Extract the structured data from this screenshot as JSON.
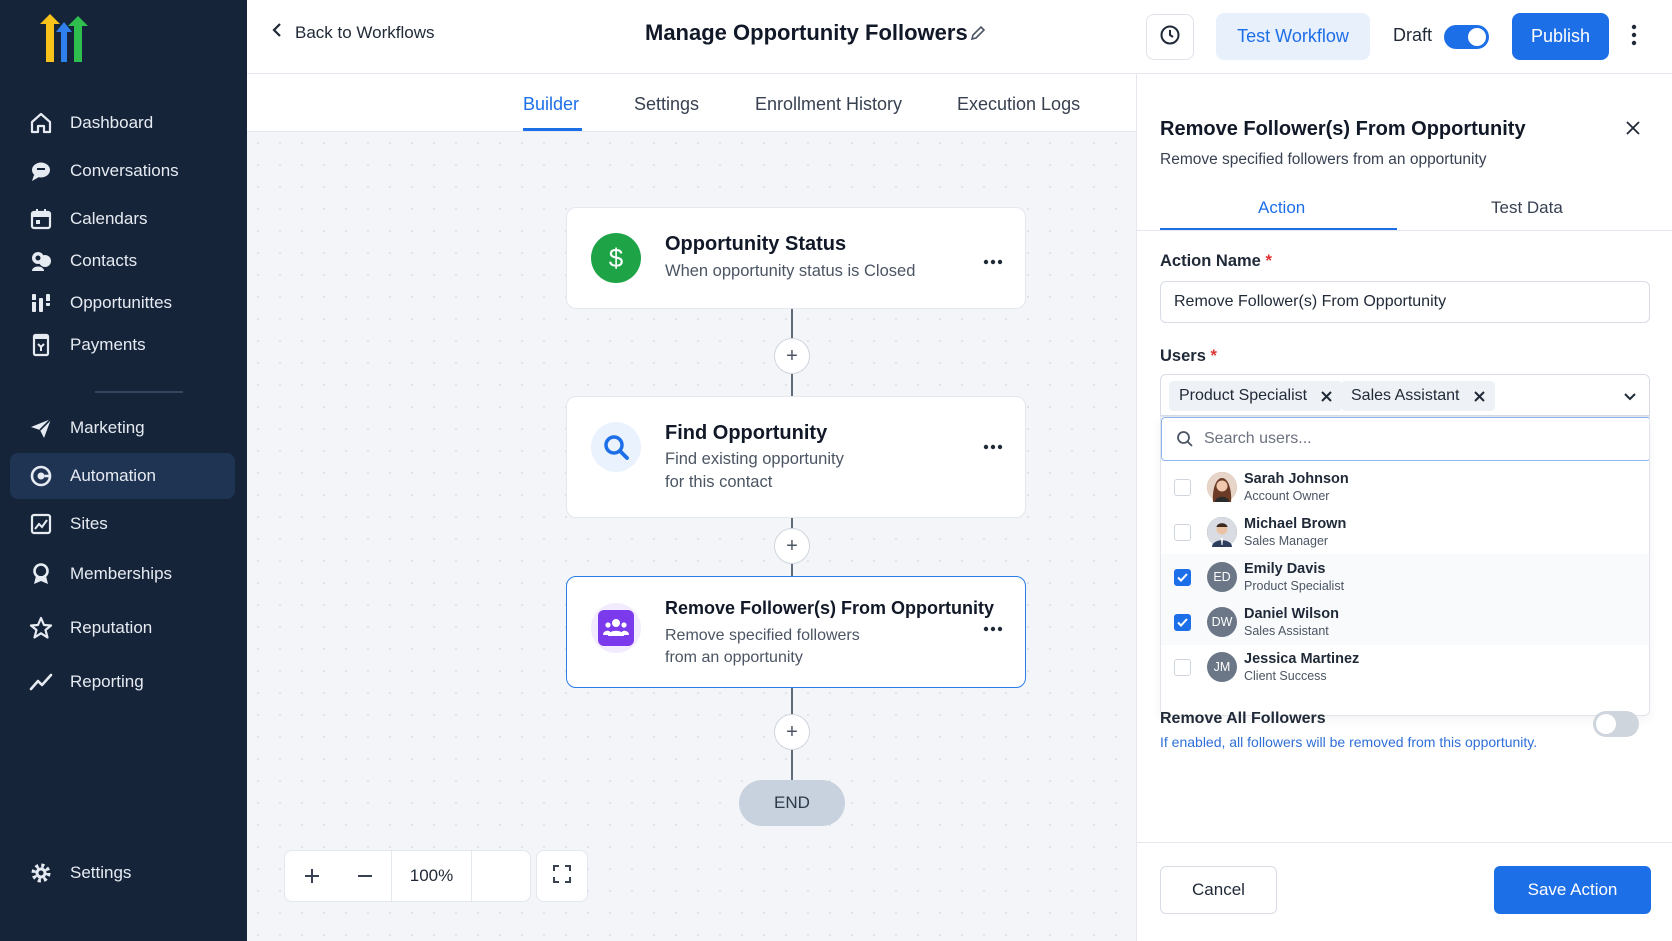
{
  "sidebar": {
    "items": [
      {
        "label": "Dashboard",
        "icon": "home-icon"
      },
      {
        "label": "Conversations",
        "icon": "chat-icon"
      },
      {
        "label": "Calendars",
        "icon": "calendar-icon"
      },
      {
        "label": "Contacts",
        "icon": "contacts-icon"
      },
      {
        "label": "Opportunittes",
        "icon": "opportunities-icon"
      },
      {
        "label": "Payments",
        "icon": "payments-icon"
      },
      {
        "label": "Marketing",
        "icon": "send-icon"
      },
      {
        "label": "Automation",
        "icon": "automation-icon",
        "active": true
      },
      {
        "label": "Sites",
        "icon": "sites-icon"
      },
      {
        "label": "Memberships",
        "icon": "membership-icon"
      },
      {
        "label": "Reputation",
        "icon": "star-icon"
      },
      {
        "label": "Reporting",
        "icon": "chart-line-icon"
      },
      {
        "label": "Settings",
        "icon": "gear-icon"
      }
    ]
  },
  "header": {
    "back_label": "Back to Workflows",
    "title": "Manage Opportunity Followers",
    "test_label": "Test Workflow",
    "draft_label": "Draft",
    "publish_label": "Publish"
  },
  "tabs": [
    "Builder",
    "Settings",
    "Enrollment History",
    "Execution Logs"
  ],
  "nodes": [
    {
      "title": "Opportunity Status",
      "sub1": "When opportunity status is Closed",
      "sub2": "",
      "icon": "dollar-icon",
      "color": "#1ea446"
    },
    {
      "title": "Find Opportunity",
      "sub1": "Find existing opportunity",
      "sub2": "for this contact",
      "icon": "search-icon",
      "color": "#1d6fe8"
    },
    {
      "title": "Remove Follower(s) From Opportunity",
      "sub1": "Remove specified followers",
      "sub2": "from an opportunity",
      "icon": "users-icon",
      "color": "#7c3aed"
    }
  ],
  "end_label": "END",
  "zoom": {
    "level": "100%"
  },
  "panel": {
    "title": "Remove Follower(s) From Opportunity",
    "subtitle": "Remove specified followers from an opportunity",
    "tabs": [
      "Action",
      "Test Data"
    ],
    "action_name_label": "Action Name",
    "action_name_value": "Remove Follower(s) From Opportunity",
    "users_label": "Users",
    "required_mark": "*",
    "selected_chips": [
      "Product Specialist",
      "Sales Assistant"
    ],
    "search_placeholder": "Search users...",
    "users": [
      {
        "name": "Sarah Johnson",
        "role": "Account Owner",
        "initials": "",
        "checked": false,
        "avatar_color": "#b0846a"
      },
      {
        "name": "Michael Brown",
        "role": "Sales Manager",
        "initials": "",
        "checked": false,
        "avatar_color": "#3f4a5a"
      },
      {
        "name": "Emily Davis",
        "role": "Product Specialist",
        "initials": "ED",
        "checked": true,
        "avatar_color": "#6b7686"
      },
      {
        "name": "Daniel Wilson",
        "role": "Sales Assistant",
        "initials": "DW",
        "checked": true,
        "avatar_color": "#6b7686"
      },
      {
        "name": "Jessica Martinez",
        "role": "Client Success",
        "initials": "JM",
        "checked": false,
        "avatar_color": "#6b7686"
      }
    ],
    "remove_all_label": "Remove All Followers",
    "remove_all_desc": "If enabled, all followers will be removed from this opportunity.",
    "cancel_label": "Cancel",
    "save_label": "Save Action"
  },
  "colors": {
    "accent": "#1d6fe8",
    "sidebar_bg": "#16243a"
  }
}
